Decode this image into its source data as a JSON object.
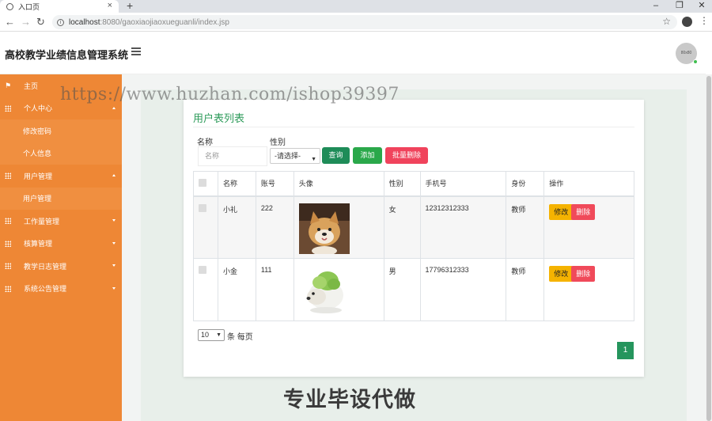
{
  "browser": {
    "tab_title": "入口页",
    "tab_close": "×",
    "new_tab": "+",
    "url_host": "localhost",
    "url_rest": ":8080/gaoxiaojiaoxueguanli/index.jsp",
    "minimize": "–",
    "restore": "❐",
    "close": "✕"
  },
  "header": {
    "app_title": "高校教学业绩信息管理系统",
    "avatar_text": "80x80"
  },
  "sidebar": {
    "items": [
      {
        "label": "主页",
        "type": "top",
        "icon": "flag-icon"
      },
      {
        "label": "个人中心",
        "type": "top",
        "icon": "grid-icon",
        "caret": "up"
      },
      {
        "label": "修改密码",
        "type": "sub"
      },
      {
        "label": "个人信息",
        "type": "sub"
      },
      {
        "label": "用户管理",
        "type": "top",
        "icon": "grid-icon",
        "caret": "up"
      },
      {
        "label": "用户管理",
        "type": "sub"
      },
      {
        "label": "工作量管理",
        "type": "top",
        "icon": "grid-icon",
        "caret": "down"
      },
      {
        "label": "核算管理",
        "type": "top",
        "icon": "grid-icon",
        "caret": "down"
      },
      {
        "label": "教学日志管理",
        "type": "top",
        "icon": "grid-icon",
        "caret": "down"
      },
      {
        "label": "系统公告管理",
        "type": "top",
        "icon": "grid-icon",
        "caret": "down"
      }
    ]
  },
  "main": {
    "title": "用户表列表",
    "filters": {
      "name_label": "名称",
      "name_placeholder": "名称",
      "gender_label": "性别",
      "gender_selected": "-请选择-"
    },
    "buttons": {
      "search": "查询",
      "add": "添加",
      "batch_delete": "批量删除"
    },
    "table": {
      "headers": [
        "名称",
        "账号",
        "头像",
        "性别",
        "手机号",
        "身份",
        "操作"
      ],
      "rows": [
        {
          "name": "小礼",
          "account": "222",
          "gender": "女",
          "phone": "12312312333",
          "role": "教师",
          "avatar": "shiba-dog-photo"
        },
        {
          "name": "小金",
          "account": "111",
          "gender": "男",
          "phone": "17796312333",
          "role": "教师",
          "avatar": "cabbage-dog-photo"
        }
      ],
      "edit_label": "修改",
      "delete_label": "删除"
    },
    "pagination": {
      "page_size": "10",
      "per_page_label": "条 每页",
      "current_page": "1"
    }
  },
  "overlay": {
    "watermark": "https://www.huzhan.com/ishop39397",
    "banner": "专业毕设代做"
  },
  "colors": {
    "sidebar": "#ee8735",
    "accent_green": "#2d9b5a",
    "search_btn": "#1e8c58",
    "add_btn": "#2aa84a",
    "delete_btn": "#f0435c",
    "edit_btn": "#f5b301"
  }
}
